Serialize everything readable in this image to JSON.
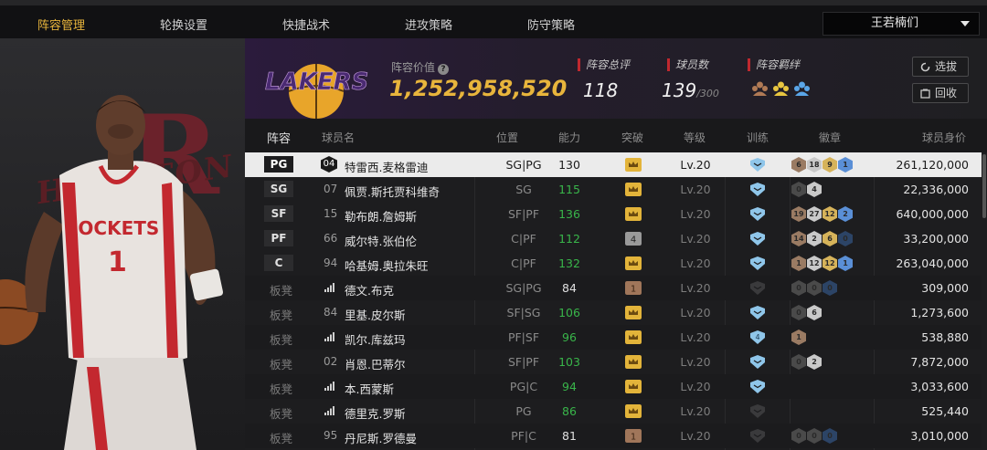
{
  "tabs": [
    "阵容管理",
    "轮换设置",
    "快捷战术",
    "进攻策略",
    "防守策略"
  ],
  "team_select": "王若楠们",
  "portrait": {
    "bg_text": "HOUSTON ROCKETS",
    "jersey_text": "ROCKETS",
    "jersey_number": "1"
  },
  "team_logo_text": "LAKERS",
  "lineup_value_label": "阵容价值",
  "lineup_value": "1,252,958,520",
  "stats": {
    "rating_label": "阵容总评",
    "rating": "118",
    "players_label": "球员数",
    "players": "139",
    "players_max": "/300",
    "bond_label": "阵容羁绊"
  },
  "buttons": {
    "scout": "选拔",
    "recycle": "回收"
  },
  "columns": [
    "阵容",
    "球员名",
    "位置",
    "能力",
    "突破",
    "等级",
    "训练",
    "徽章",
    "球员身价"
  ],
  "rows": [
    {
      "slot": "PG",
      "num": "04",
      "name": "特雷西.麦格雷迪",
      "pos": "SG|PG",
      "ability": "130",
      "green": false,
      "level": "Lv.20",
      "badges": [
        {
          "t": "6",
          "c": "#9a7b63"
        },
        {
          "t": "18",
          "c": "#c9c9c9"
        },
        {
          "t": "9",
          "c": "#d6b35a"
        },
        {
          "t": "1",
          "c": "#5a8fd6"
        }
      ],
      "value": "261,120,000"
    },
    {
      "slot": "SG",
      "num": "07",
      "name": "佩贾.斯托贾科维奇",
      "pos": "SG",
      "ability": "115",
      "green": true,
      "level": "Lv.20",
      "badges": [
        {
          "t": "0",
          "c": "#4a4a4a"
        },
        {
          "t": "4",
          "c": "#c9c9c9"
        }
      ],
      "value": "22,336,000"
    },
    {
      "slot": "SF",
      "num": "15",
      "name": "勒布朗.詹姆斯",
      "pos": "SF|PF",
      "ability": "136",
      "green": true,
      "level": "Lv.20",
      "badges": [
        {
          "t": "19",
          "c": "#9a7b63"
        },
        {
          "t": "27",
          "c": "#c9c9c9"
        },
        {
          "t": "12",
          "c": "#d6b35a"
        },
        {
          "t": "2",
          "c": "#5a8fd6"
        }
      ],
      "value": "640,000,000"
    },
    {
      "slot": "PF",
      "num": "66",
      "name": "威尔特.张伯伦",
      "pos": "C|PF",
      "ability": "112",
      "green": true,
      "level": "Lv.20",
      "badges": [
        {
          "t": "14",
          "c": "#9a7b63"
        },
        {
          "t": "2",
          "c": "#c9c9c9"
        },
        {
          "t": "6",
          "c": "#d6b35a"
        },
        {
          "t": "0",
          "c": "#2c4466"
        }
      ],
      "value": "33,200,000"
    },
    {
      "slot": "C",
      "num": "94",
      "name": "哈基姆.奥拉朱旺",
      "pos": "C|PF",
      "ability": "132",
      "green": true,
      "level": "Lv.20",
      "badges": [
        {
          "t": "1",
          "c": "#9a7b63"
        },
        {
          "t": "12",
          "c": "#c9c9c9"
        },
        {
          "t": "12",
          "c": "#d6b35a"
        },
        {
          "t": "1",
          "c": "#5a8fd6"
        }
      ],
      "value": "263,040,000"
    },
    {
      "slot": "板凳",
      "num": "",
      "name": "德文.布克",
      "pos": "SG|PG",
      "ability": "84",
      "green": false,
      "level": "Lv.20",
      "badges": [
        {
          "t": "0",
          "c": "#4a4a4a"
        },
        {
          "t": "0",
          "c": "#4a4a4a"
        },
        {
          "t": "0",
          "c": "#2c4466"
        }
      ],
      "value": "309,000"
    },
    {
      "slot": "板凳",
      "num": "84",
      "name": "里基.皮尔斯",
      "pos": "SF|SG",
      "ability": "106",
      "green": true,
      "level": "Lv.20",
      "badges": [
        {
          "t": "0",
          "c": "#4a4a4a"
        },
        {
          "t": "6",
          "c": "#c9c9c9"
        }
      ],
      "value": "1,273,600"
    },
    {
      "slot": "板凳",
      "num": "",
      "name": "凯尔.库兹玛",
      "pos": "PF|SF",
      "ability": "96",
      "green": true,
      "level": "Lv.20",
      "badges": [
        {
          "t": "1",
          "c": "#9a7b63"
        }
      ],
      "value": "538,880"
    },
    {
      "slot": "板凳",
      "num": "02",
      "name": "肖恩.巴蒂尔",
      "pos": "SF|PF",
      "ability": "103",
      "green": true,
      "level": "Lv.20",
      "badges": [
        {
          "t": "0",
          "c": "#4a4a4a"
        },
        {
          "t": "2",
          "c": "#c9c9c9"
        }
      ],
      "value": "7,872,000"
    },
    {
      "slot": "板凳",
      "num": "",
      "name": "本.西蒙斯",
      "pos": "PG|C",
      "ability": "94",
      "green": true,
      "level": "Lv.20",
      "badges": [],
      "value": "3,033,600"
    },
    {
      "slot": "板凳",
      "num": "",
      "name": "德里克.罗斯",
      "pos": "PG",
      "ability": "86",
      "green": true,
      "level": "Lv.20",
      "badges": [],
      "value": "525,440"
    },
    {
      "slot": "板凳",
      "num": "95",
      "name": "丹尼斯.罗德曼",
      "pos": "PF|C",
      "ability": "81",
      "green": false,
      "level": "Lv.20",
      "badges": [
        {
          "t": "0",
          "c": "#4a4a4a"
        },
        {
          "t": "0",
          "c": "#4a4a4a"
        },
        {
          "t": "0",
          "c": "#2c4466"
        }
      ],
      "value": "3,010,000"
    }
  ]
}
